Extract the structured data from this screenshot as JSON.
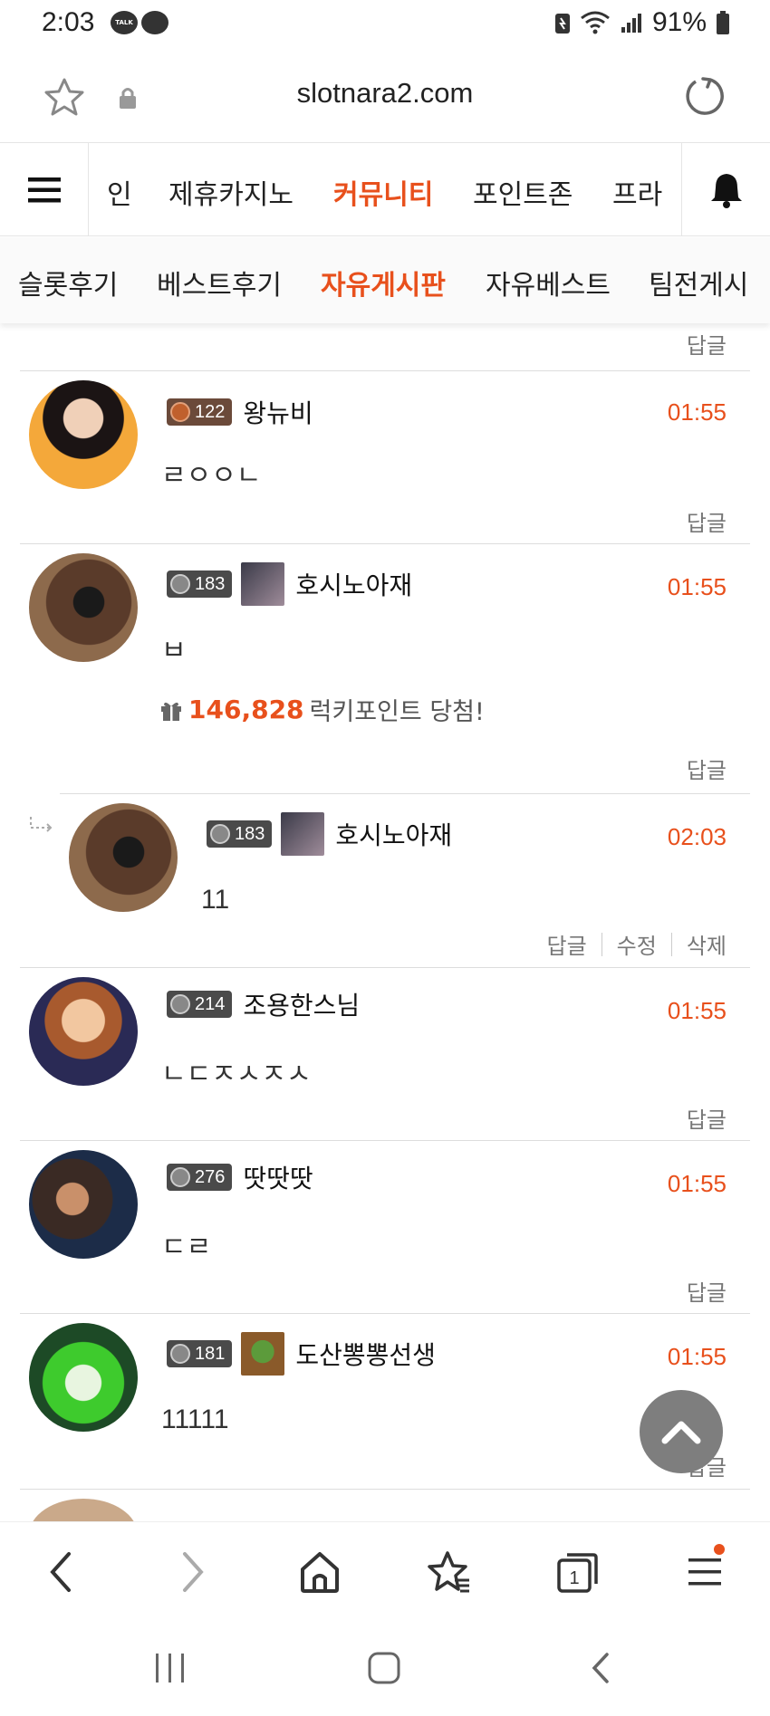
{
  "status": {
    "time": "2:03",
    "talk_badge": "TALK",
    "battery": "91%"
  },
  "url_bar": {
    "url": "slotnara2.com"
  },
  "main_nav": {
    "items": [
      {
        "label": "인",
        "active": false
      },
      {
        "label": "제휴카지노",
        "active": false
      },
      {
        "label": "커뮤니티",
        "active": true
      },
      {
        "label": "포인트존",
        "active": false
      },
      {
        "label": "프라",
        "active": false
      }
    ]
  },
  "sub_nav": {
    "items": [
      {
        "label": "슬롯후기",
        "active": false
      },
      {
        "label": "베스트후기",
        "active": false
      },
      {
        "label": "자유게시판",
        "active": true
      },
      {
        "label": "자유베스트",
        "active": false
      },
      {
        "label": "팀전게시",
        "active": false
      }
    ]
  },
  "top_reply_label": "답글",
  "comments": [
    {
      "level": "122",
      "nickname": "왕뉴비",
      "time": "01:55",
      "text": "ㄹㅇㅇㄴ",
      "reply": "답글"
    },
    {
      "level": "183",
      "nickname": "호시노아재",
      "time": "01:55",
      "text": "ㅂ",
      "lucky_amount": "146,828",
      "lucky_text": "럭키포인트 당첨!",
      "reply": "답글"
    },
    {
      "level": "183",
      "nickname": "호시노아재",
      "time": "02:03",
      "text": "11",
      "reply": "답글",
      "edit": "수정",
      "delete": "삭제"
    },
    {
      "level": "214",
      "nickname": "조용한스님",
      "time": "01:55",
      "text": "ㄴㄷㅈㅅㅈㅅ",
      "reply": "답글"
    },
    {
      "level": "276",
      "nickname": "땃땃땃",
      "time": "01:55",
      "text": "ㄷㄹ",
      "reply": "답글"
    },
    {
      "level": "181",
      "nickname": "도산뽕뽕선생",
      "time": "01:55",
      "text": "11111",
      "reply": "답글"
    }
  ],
  "colors": {
    "accent": "#e8501c",
    "text": "#222222",
    "muted": "#777777"
  }
}
